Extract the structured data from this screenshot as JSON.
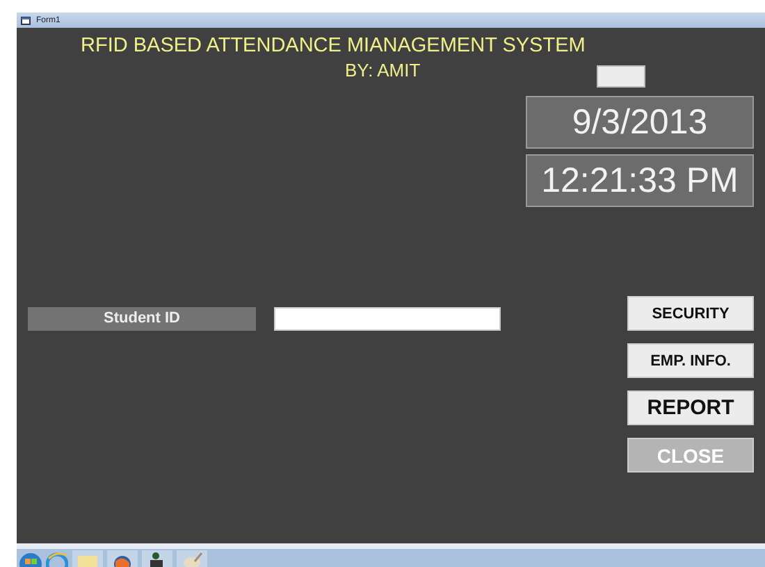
{
  "window": {
    "title": "Form1"
  },
  "heading": {
    "title": "RFID BASED ATTENDANCE MIANAGEMENT SYSTEM",
    "byline": "BY: AMIT"
  },
  "date": "9/3/2013",
  "time": "12:21:33 PM",
  "student_id": {
    "label": "Student ID"
  },
  "buttons": [
    {
      "label": "SECURITY",
      "disabled": false
    },
    {
      "label": "EMP. INFO.",
      "disabled": false
    },
    {
      "label": "REPORT",
      "disabled": false
    },
    {
      "label": "CLOSE",
      "disabled": true
    }
  ]
}
